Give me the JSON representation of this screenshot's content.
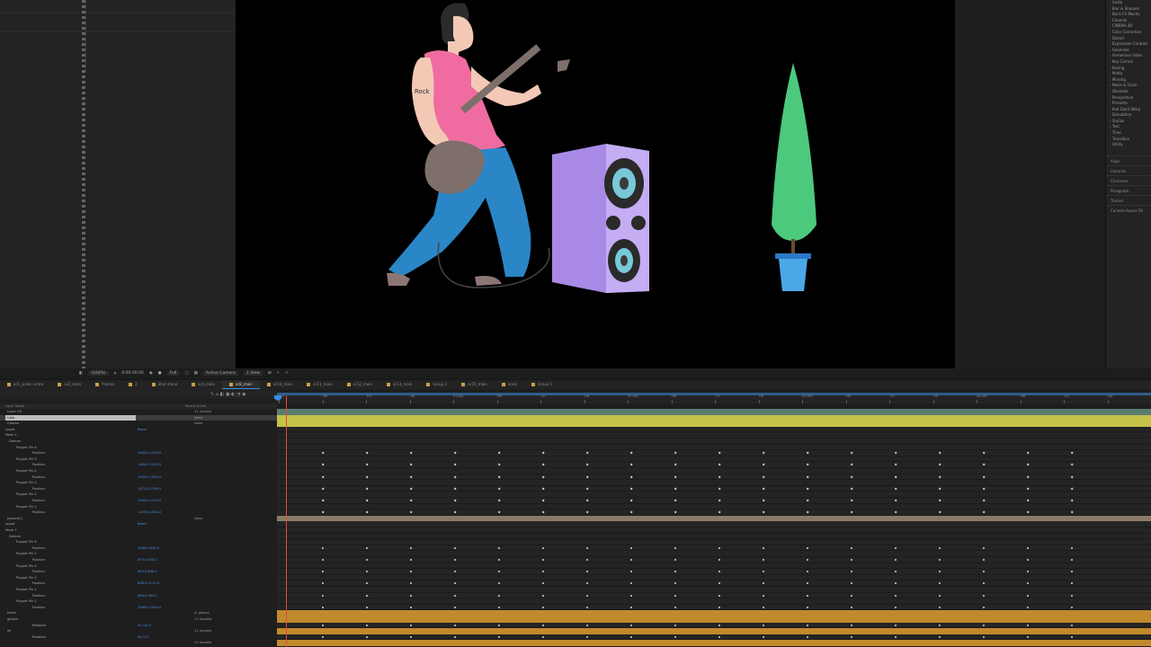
{
  "viewer_toolbar": {
    "zoom": "(100%)",
    "timecode": "0:00:00:00",
    "resolution": "Full",
    "camera": "Active Camera",
    "view": "1 View"
  },
  "effects_panel": {
    "categories": [
      "Audio",
      "Blur & Sharpen",
      "Boris FX Mocha",
      "Channel",
      "CINEMA 4D",
      "Color Correction",
      "Distort",
      "Expression Controls",
      "Generate",
      "Immersive Video",
      "Key Correct",
      "Keying",
      "Matte",
      "Missing",
      "Noise & Grain",
      "Obsolete",
      "Perspective",
      "Primatte",
      "Red Giant Warp",
      "Simulation",
      "Stylize",
      "Text",
      "Time",
      "Transition",
      "Utility"
    ],
    "panels": [
      "Align",
      "Libraries",
      "Character",
      "Paragraph",
      "Tracker",
      "Content-Aware Fill"
    ]
  },
  "comp_tabs": [
    {
      "label": "sc1_scale i entre",
      "active": false
    },
    {
      "label": "sc2_main",
      "active": false
    },
    {
      "label": "frames",
      "active": false
    },
    {
      "label": "2",
      "active": false
    },
    {
      "label": "Shot stone",
      "active": false
    },
    {
      "label": "sc4_main",
      "active": false
    },
    {
      "label": "sc8_main",
      "active": true
    },
    {
      "label": "sc10_main",
      "active": false
    },
    {
      "label": "sc11_main",
      "active": false
    },
    {
      "label": "sc12_main",
      "active": false
    },
    {
      "label": "sc13_main",
      "active": false
    },
    {
      "label": "Group 1",
      "active": false
    },
    {
      "label": "sc15_main",
      "active": false
    },
    {
      "label": "scale",
      "active": false
    },
    {
      "label": "Group 1",
      "active": false
    }
  ],
  "timeline": {
    "header_layer_name": "Layer Name",
    "header_parent": "Parent & Link",
    "ruler_labels": [
      "00f",
      "06f",
      "12f",
      "18f",
      "01:00f",
      "06f",
      "12f",
      "18f",
      "02:00f",
      "06f",
      "12f",
      "18f",
      "03:00f",
      "06f",
      "12f",
      "18f",
      "04:00f",
      "06f",
      "12f",
      "18f",
      "05:00f"
    ],
    "layers": [
      {
        "name": "Layer 26",
        "parent": "11 kosulka",
        "kind": "layer"
      },
      {
        "name": "ruka",
        "parent": "None",
        "kind": "layer-selected"
      },
      {
        "name": "Gitarka",
        "parent": "None",
        "kind": "layer"
      },
      {
        "name": "uppet",
        "value": "Reset",
        "kind": "prop"
      },
      {
        "name": "Mesh 1",
        "kind": "prop"
      },
      {
        "name": "Deform",
        "kind": "prop"
      },
      {
        "name": "Puppet Pin 6",
        "kind": "prop"
      },
      {
        "name": "Position",
        "value": "1484.0,1293.0",
        "kind": "pos"
      },
      {
        "name": "Puppet Pin 5",
        "kind": "prop"
      },
      {
        "name": "Position",
        "value": "1484.0,1453.0",
        "kind": "pos"
      },
      {
        "name": "Puppet Pin 4",
        "kind": "prop"
      },
      {
        "name": "Position",
        "value": "1484.0,1093.0",
        "kind": "pos"
      },
      {
        "name": "Puppet Pin 3",
        "kind": "prop"
      },
      {
        "name": "Position",
        "value": "1073.0,1764.0",
        "kind": "pos"
      },
      {
        "name": "Puppet Pin 2",
        "kind": "prop"
      },
      {
        "name": "Position",
        "value": "1484.0,1703.0",
        "kind": "pos"
      },
      {
        "name": "Puppet Pin 1",
        "kind": "prop"
      },
      {
        "name": "Position",
        "value": "1109.0,1613.0",
        "kind": "pos"
      },
      {
        "name": "[pasonki]",
        "parent": "None",
        "kind": "layer"
      },
      {
        "name": "uppet",
        "value": "Reset",
        "kind": "prop"
      },
      {
        "name": "Mesh 1",
        "kind": "prop"
      },
      {
        "name": "Deform",
        "kind": "prop"
      },
      {
        "name": "Puppet Pin 6",
        "kind": "prop"
      },
      {
        "name": "Position",
        "value": "1089.0,844.0",
        "kind": "pos"
      },
      {
        "name": "Puppet Pin 5",
        "kind": "prop"
      },
      {
        "name": "Position",
        "value": "870.0,870.0",
        "kind": "pos"
      },
      {
        "name": "Puppet Pin 4",
        "kind": "prop"
      },
      {
        "name": "Position",
        "value": "800.0,846.0",
        "kind": "pos"
      },
      {
        "name": "Puppet Pin 3",
        "kind": "prop"
      },
      {
        "name": "Position",
        "value": "806.0,1113.0",
        "kind": "pos"
      },
      {
        "name": "Puppet Pin 2",
        "kind": "prop"
      },
      {
        "name": "Position",
        "value": "866.0,985.0",
        "kind": "pos"
      },
      {
        "name": "Puppet Pin 1",
        "kind": "prop"
      },
      {
        "name": "Position",
        "value": "1089.0,1094.0",
        "kind": "pos"
      },
      {
        "name": "telme",
        "parent": "4. golova",
        "kind": "layer"
      },
      {
        "name": "golova",
        "parent": "11 kosulka",
        "kind": "layer"
      },
      {
        "name": "Rotation",
        "value": "0x-10.0°",
        "kind": "pos"
      },
      {
        "name": "lik",
        "parent": "11 kosulka",
        "kind": "layer"
      },
      {
        "name": "Rotation",
        "value": "0x-4.0°",
        "kind": "pos"
      },
      {
        "name": "",
        "parent": "11 kosulka",
        "kind": "layer"
      }
    ]
  }
}
